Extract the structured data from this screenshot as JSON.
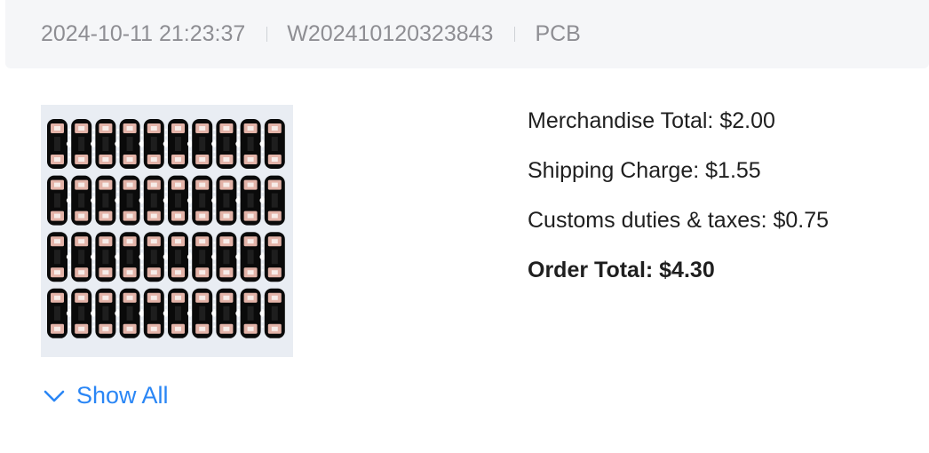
{
  "order": {
    "datetime": "2024-10-11 21:23:37",
    "order_id": "W202410120323843",
    "product_type": "PCB"
  },
  "thumbnail": {
    "icon": "pcb-panel-image"
  },
  "summary": {
    "merchandise_total": "Merchandise Total: $2.00",
    "shipping_charge": "Shipping Charge: $1.55",
    "customs_duties": "Customs duties & taxes: $0.75",
    "order_total": "Order Total: $4.30"
  },
  "show_all": {
    "label": "Show All",
    "icon": "chevron-down-icon"
  },
  "colors": {
    "header_bg": "#f5f6f8",
    "muted_text": "#8e8e93",
    "link": "#2a86f5",
    "pcb_board": "#0a0a0a",
    "pcb_pad": "#e3b3a8"
  }
}
